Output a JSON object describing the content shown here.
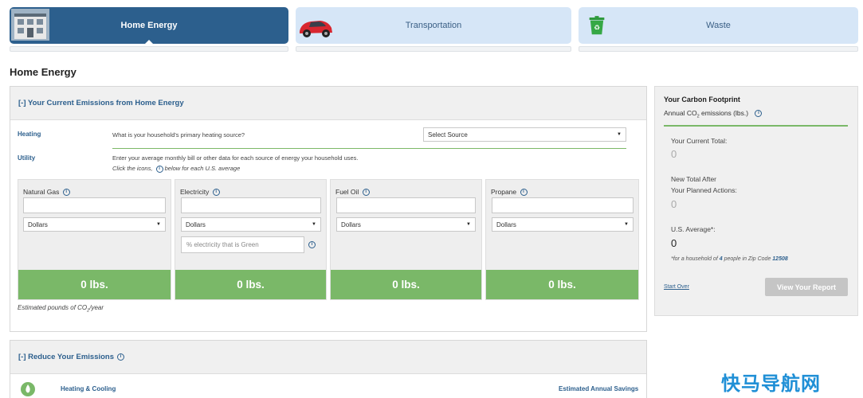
{
  "tabs": [
    {
      "label": "Home Energy",
      "icon": "house-icon",
      "active": true
    },
    {
      "label": "Transportation",
      "icon": "car-icon",
      "active": false
    },
    {
      "label": "Waste",
      "icon": "recycle-bin-icon",
      "active": false
    }
  ],
  "page_title": "Home Energy",
  "current_emissions": {
    "header": "[-] Your Current Emissions from Home Energy",
    "heating_label": "Heating",
    "heating_question": "What is your household's primary heating source?",
    "heating_select": "Select Source",
    "utility_label": "Utility",
    "utility_instruction": "Enter your average monthly bill or other data for each source of energy your household uses.",
    "utility_hint_pre": "Click the icons,",
    "utility_hint_post": "below for each U.S. average",
    "cards": [
      {
        "label": "Natural Gas",
        "unit": "Dollars",
        "result": "0 lbs."
      },
      {
        "label": "Electricity",
        "unit": "Dollars",
        "result": "0 lbs.",
        "green_placeholder": "% electricity that is Green"
      },
      {
        "label": "Fuel Oil",
        "unit": "Dollars",
        "result": "0 lbs."
      },
      {
        "label": "Propane",
        "unit": "Dollars",
        "result": "0 lbs."
      }
    ],
    "footnote_pre": "Estimated pounds of CO",
    "footnote_sub": "2",
    "footnote_post": "/year"
  },
  "reduce": {
    "header": "[-] Reduce Your Emissions",
    "row_label": "Heating & Cooling",
    "savings_label": "Estimated Annual Savings"
  },
  "footprint": {
    "title": "Your Carbon Footprint",
    "subtitle_pre": "Annual CO",
    "subtitle_sub": "2",
    "subtitle_post": " emissions (lbs.)",
    "current_label": "Your Current Total:",
    "current_value": "0",
    "new_label_1": "New Total After",
    "new_label_2": "Your Planned Actions:",
    "new_value": "0",
    "us_label": "U.S. Average*:",
    "us_value": "0",
    "note_pre": "*for a household of ",
    "note_people": "4",
    "note_mid": " people in Zip Code ",
    "note_zip": "12508",
    "start_over": "Start Over",
    "report_button": "View Your Report"
  },
  "info_glyph": "i",
  "colors": {
    "primary": "#2c5f8d",
    "tab_inactive": "#d6e6f7",
    "green": "#7ab868"
  },
  "watermark": "快马导航网"
}
